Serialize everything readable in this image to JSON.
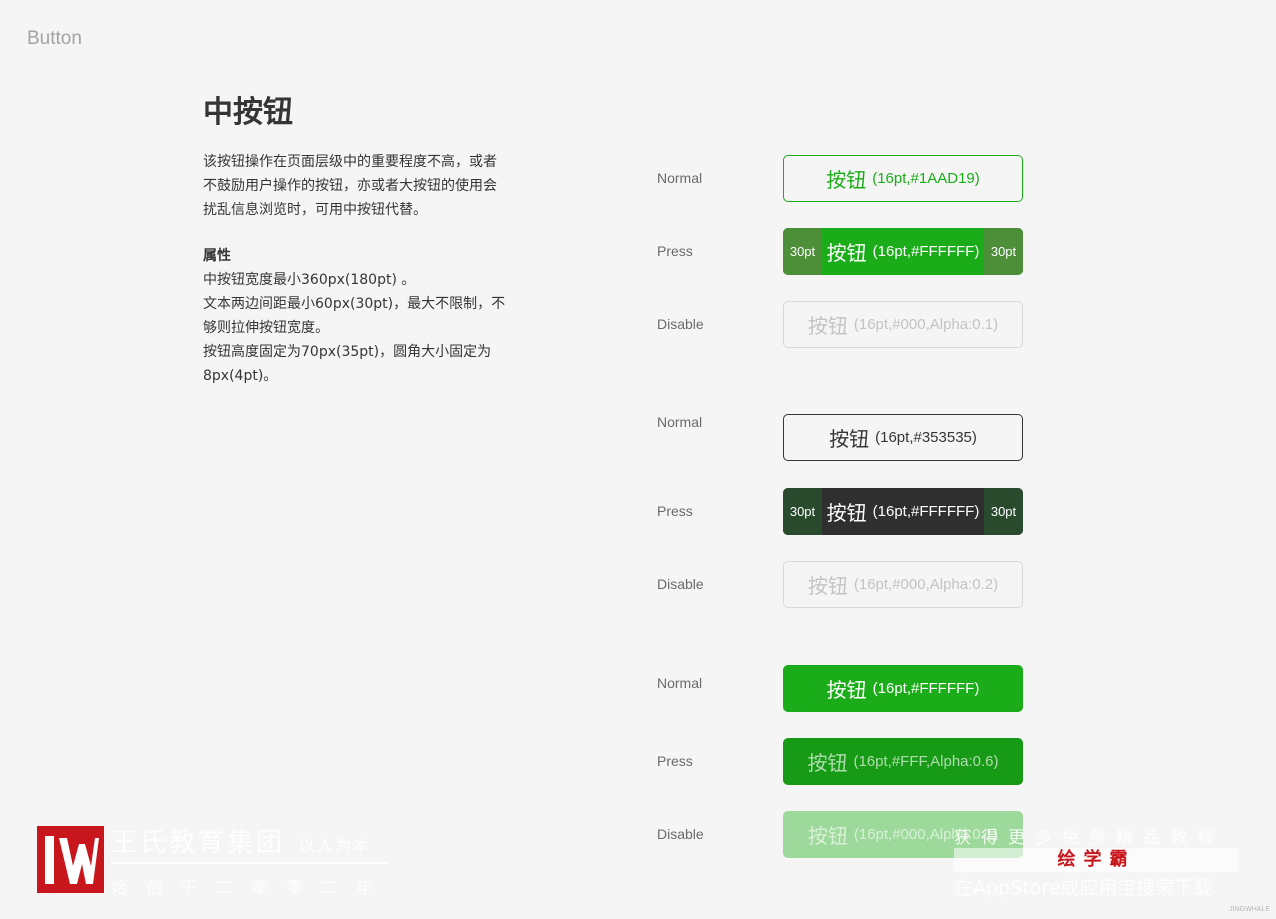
{
  "page_label": "Button",
  "title": "中按钮",
  "description": [
    "该按钮操作在页面层级中的重要程度不高，或者",
    "不鼓励用户操作的按钮，亦或者大按钮的使用会",
    "扰乱信息浏览时，可用中按钮代替。"
  ],
  "properties": {
    "title": "属性",
    "lines": [
      "中按钮宽度最小360px(180pt) 。",
      "文本两边间距最小60px(30pt)，最大不限制，不",
      "够则拉伸按钮宽度。",
      "按钮高度固定为70px(35pt)，圆角大小固定为",
      "8px(4pt)。"
    ]
  },
  "state_labels": {
    "normal": "Normal",
    "press": "Press",
    "disable": "Disable"
  },
  "padding_label": "30pt",
  "groups": [
    {
      "normal": {
        "label": "按钮",
        "note": "(16pt,#1AAD19)"
      },
      "press": {
        "label": "按钮",
        "note": "(16pt,#FFFFFF)"
      },
      "disable": {
        "label": "按钮",
        "note": "(16pt,#000,Alpha:0.1)"
      }
    },
    {
      "normal": {
        "label": "按钮",
        "note": "(16pt,#353535)"
      },
      "press": {
        "label": "按钮",
        "note": "(16pt,#FFFFFF)"
      },
      "disable": {
        "label": "按钮",
        "note": "(16pt,#000,Alpha:0.2)"
      }
    },
    {
      "normal": {
        "label": "按钮",
        "note": "(16pt,#FFFFFF)"
      },
      "press": {
        "label": "按钮",
        "note": "(16pt,#FFF,Alpha:0.6)"
      },
      "disable": {
        "label": "按钮",
        "note": "(16pt,#000,Alpha:0.1)"
      }
    }
  ],
  "colors": {
    "primary": "#1AAD19",
    "dark": "#353535",
    "background": "#F5F5F5"
  },
  "watermark": {
    "brand": "王氏教育集团",
    "slogan": "以人为本",
    "since": "始创于二零零二年",
    "right_line1": "获得更多免费精品教程",
    "right_brand": "绘学霸",
    "right_line3": "在AppStore或应用宝搜索下载",
    "tiny": "JINGWHALE"
  }
}
